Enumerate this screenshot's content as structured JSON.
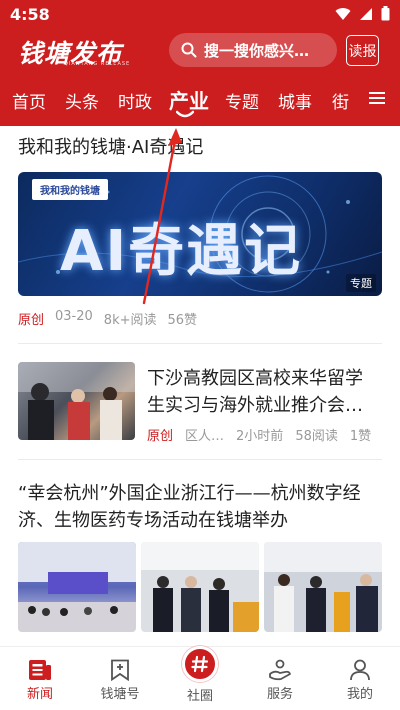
{
  "status_bar": {
    "time": "4:58"
  },
  "header": {
    "logo_text": "钱塘发布",
    "logo_sub": "QIANTANG RELEASE",
    "search_placeholder": "搜一搜你感兴…",
    "paper_button": "读报",
    "tabs": [
      "首页",
      "头条",
      "时政",
      "产业",
      "专题",
      "城事",
      "街"
    ],
    "active_tab": "产业",
    "colors": {
      "brand": "#cc1d1f"
    }
  },
  "feed": {
    "article1": {
      "title": "我和我的钱塘·AI奇遇记",
      "banner_tag": "我和我的钱塘",
      "banner_title": "AI奇遇记",
      "banner_label": "专题",
      "source": "原创",
      "date": "03-20",
      "reads": "8k+阅读",
      "likes": "56赞"
    },
    "article2": {
      "title_line1": "下沙高教园区高校来华留学",
      "title_line2": "生实习与海外就业推介会…",
      "source": "原创",
      "author": "区人…",
      "time": "2小时前",
      "reads": "58阅读",
      "likes": "1赞"
    },
    "article3": {
      "title_line1": "“幸会杭州”外国企业浙江行——杭州数字经",
      "title_line2": "济、生物医药专场活动在钱塘举办"
    }
  },
  "bottom_nav": {
    "items": [
      "新闻",
      "钱塘号",
      "社圈",
      "服务",
      "我的"
    ],
    "active": "新闻"
  }
}
